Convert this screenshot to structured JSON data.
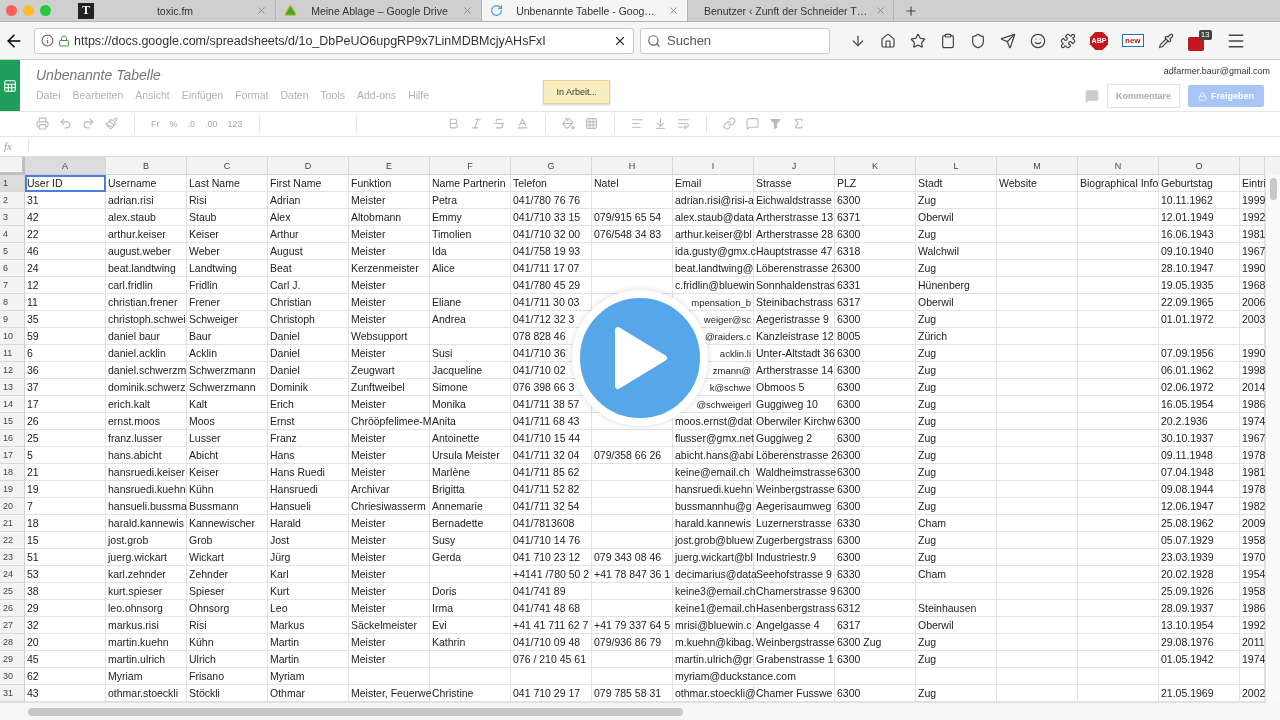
{
  "browser": {
    "tabs": [
      {
        "favicon": "T",
        "title": "toxic.fm",
        "selected": false
      },
      {
        "title": "Meine Ablage – Google Drive",
        "selected": false
      },
      {
        "title": "Unbenannte Tabelle - Goog…",
        "selected": true
      },
      {
        "title": "Benutzer ‹ Zunft der Schneider T…",
        "selected": false
      }
    ],
    "url": "https://docs.google.com/spreadsheets/d/1o_DbPeUO6upgRP9x7LinMDBMcjyAHsFxI",
    "search": {
      "placeholder": "Suchen"
    },
    "adblock": "ABP",
    "news": "new",
    "badge": "13"
  },
  "sheet": {
    "title": "Unbenannte Tabelle",
    "menus": [
      "Datei",
      "Bearbeiten",
      "Ansicht",
      "Einfügen",
      "Format",
      "Daten",
      "Tools",
      "Add-ons",
      "Hilfe"
    ],
    "status": "In Arbeit...",
    "account": "adfarmer.baur@gmail.com",
    "comments": "Kommentare",
    "share": "Freigeben"
  },
  "toolbar": {
    "labels": [
      "Fr",
      "%",
      ".0",
      ".00",
      "123"
    ]
  },
  "formula_bar": {
    "label": "fx"
  },
  "grid": {
    "columns": [
      "A",
      "B",
      "C",
      "D",
      "E",
      "F",
      "G",
      "H",
      "I",
      "J",
      "K",
      "L",
      "M",
      "N",
      "O",
      null
    ],
    "rows": [
      {
        "number": "1",
        "cells": [
          {
            "text": "User ID",
            "selected": true
          },
          "Username",
          "Last Name",
          "First Name",
          "Funktion",
          "Name Partnerin",
          "Telefon",
          "Natel",
          "Email",
          "Strasse",
          "PLZ",
          "Stadt",
          "Website",
          "Biographical Info",
          "Geburtstag",
          "Eintri"
        ]
      },
      {
        "number": "2",
        "cells": [
          "31",
          "adrian.risi",
          "Risi",
          "Adrian",
          "Meister",
          "Petra",
          "041/780 76 76",
          null,
          "adrian.risi@risi-a",
          "Eichwaldstrasse",
          "6300",
          "Zug",
          null,
          null,
          "10.11.1962",
          "1999"
        ]
      },
      {
        "number": "3",
        "cells": [
          "42",
          "alex.staub",
          "Staub",
          "Alex",
          "Altobmann",
          "Emmy",
          "041/710 33 15",
          "079/915 65 54",
          "alex.staub@data",
          "Artherstrasse 13",
          "6371",
          "Oberwil",
          null,
          null,
          "12.01.1949",
          "1992"
        ]
      },
      {
        "number": "4",
        "cells": [
          "22",
          "arthur.keiser",
          "Keiser",
          "Arthur",
          "Meister",
          "Timolien",
          "041/710 32 00",
          "076/548 34 83",
          "arthur.keiser@bl",
          "Artherstrasse 28",
          "6300",
          "Zug",
          null,
          null,
          "16.06.1943",
          "1981"
        ]
      },
      {
        "number": "5",
        "cells": [
          "46",
          "august.weber",
          "Weber",
          "August",
          "Meister",
          "Ida",
          "041/758 19 93",
          null,
          "ida.gusty@gmx.c",
          "Hauptstrasse 47",
          "6318",
          "Walchwil",
          null,
          null,
          "09.10.1940",
          "1967"
        ]
      },
      {
        "number": "6",
        "cells": [
          "24",
          "beat.landtwing",
          "Landtwing",
          "Beat",
          "Kerzenmeister",
          "Alice",
          "041/711 17 07",
          null,
          "beat.landtwing@",
          "Löberenstrasse 2",
          "6300",
          "Zug",
          null,
          null,
          "28.10.1947",
          "1990"
        ]
      },
      {
        "number": "7",
        "cells": [
          "12",
          "carl.fridlin",
          "Fridlin",
          "Carl J.",
          "Meister",
          null,
          "041/780 45 29",
          null,
          "c.fridlin@bluewin",
          "Sonnhaldenstras",
          "6331",
          "Hünenberg",
          null,
          null,
          "19.05.1935",
          "1968"
        ]
      },
      {
        "number": "8",
        "cells": [
          "11",
          "christian.frener",
          "Frener",
          "Christian",
          "Meister",
          "Eliane",
          "041/711 30 03",
          null,
          {
            "text": "mpensation_b",
            "covered": true
          },
          "Steinibachstrass",
          "6317",
          "Oberwil",
          null,
          null,
          "22.09.1965",
          "2006"
        ]
      },
      {
        "number": "9",
        "cells": [
          "35",
          "christoph.schwei",
          "Schweiger",
          "Christoph",
          "Meister",
          "Andrea",
          "041/712 32 3",
          null,
          {
            "text": "weiger@sc",
            "covered": true
          },
          "Aegeristrasse 9",
          "6300",
          "Zug",
          null,
          null,
          "01.01.1972",
          "2003"
        ]
      },
      {
        "number": "10",
        "cells": [
          "59",
          "daniel baur",
          "Baur",
          "Daniel",
          "Websupport",
          null,
          "078 828 46",
          null,
          {
            "text": "@raiders.c",
            "covered": true
          },
          "Kanzleistrase 12",
          "8005",
          "Zürich",
          null,
          null,
          null,
          null
        ]
      },
      {
        "number": "11",
        "cells": [
          "6",
          "daniel.acklin",
          "Acklin",
          "Daniel",
          "Meister",
          "Susi",
          "041/710 36",
          null,
          {
            "text": "acklin.li",
            "covered": true
          },
          "Unter-Altstadt 36",
          "6300",
          "Zug",
          null,
          null,
          "07.09.1956",
          "1990"
        ]
      },
      {
        "number": "12",
        "cells": [
          "36",
          "daniel.schwerzm",
          "Schwerzmann",
          "Daniel",
          "Zeugwart",
          "Jacqueline",
          "041/710 02",
          null,
          {
            "text": "zmann@",
            "covered": true
          },
          "Artherstrasse 14",
          "6300",
          "Zug",
          null,
          null,
          "06.01.1962",
          "1998"
        ]
      },
      {
        "number": "13",
        "cells": [
          "37",
          "dominik.schwerz",
          "Schwerzmann",
          "Dominik",
          "Zunftweibel",
          "Simone",
          "076 398 66 3",
          null,
          {
            "text": "k@schwe",
            "covered": true
          },
          "Obmoos 5",
          "6300",
          "Zug",
          null,
          null,
          "02.06.1972",
          "2014"
        ]
      },
      {
        "number": "14",
        "cells": [
          "17",
          "erich.kalt",
          "Kalt",
          "Erich",
          "Meister",
          "Monika",
          "041/711 38 57",
          null,
          {
            "text": "@schweigerl",
            "covered": true
          },
          "Guggiweg 10",
          "6300",
          "Zug",
          null,
          null,
          "16.05.1954",
          "1986"
        ]
      },
      {
        "number": "15",
        "cells": [
          "26",
          "ernst.moos",
          "Moos",
          "Ernst",
          "Chrööpfelimee-M",
          "Anita",
          "041/711 68 43",
          null,
          "moos.ernst@dat",
          "Oberwiler Kirchw",
          "6300",
          "Zug",
          null,
          null,
          "20.2.1936",
          "1974"
        ]
      },
      {
        "number": "16",
        "cells": [
          "25",
          "franz.lusser",
          "Lusser",
          "Franz",
          "Meister",
          "Antoinette",
          "041/710 15 44",
          null,
          "flusser@gmx.net",
          "Guggiweg 2",
          "6300",
          "Zug",
          null,
          null,
          "30.10.1937",
          "1967"
        ]
      },
      {
        "number": "17",
        "cells": [
          "5",
          "hans.abicht",
          "Abicht",
          "Hans",
          "Meister",
          "Ursula Meister",
          "041/711 32 04",
          "079/358 66 26",
          "abicht.hans@abi",
          "Löberenstrasse 2",
          "6300",
          "Zug",
          null,
          null,
          "09.11.1948",
          "1978"
        ]
      },
      {
        "number": "18",
        "cells": [
          "21",
          "hansruedi.keiser",
          "Keiser",
          "Hans Ruedi",
          "Meister",
          "Marlène",
          "041/711 85 62",
          null,
          "keine@email.ch",
          "Waldheimstrasse",
          "6300",
          "Zug",
          null,
          null,
          "07.04.1948",
          "1981"
        ]
      },
      {
        "number": "19",
        "cells": [
          "19",
          "hansruedi.kuehn",
          "Kühn",
          "Hansruedi",
          "Archivar",
          "Brigitta",
          "041/711 52 82",
          null,
          "hansruedi.kuehn",
          "Weinbergstrasse",
          "6300",
          "Zug",
          null,
          null,
          "09.08.1944",
          "1978"
        ]
      },
      {
        "number": "20",
        "cells": [
          "7",
          "hansueli.bussma",
          "Bussmann",
          "Hansueli",
          "Chriesiwasserm",
          "Annemarie",
          "041/711 32 54",
          null,
          "bussmannhu@g",
          "Aegerisaumweg",
          "6300",
          "Zug",
          null,
          null,
          "12.06.1947",
          "1982"
        ]
      },
      {
        "number": "21",
        "cells": [
          "18",
          "harald.kannewis",
          "Kannewischer",
          "Harald",
          "Meister",
          "Bernadette",
          "041/7813608",
          null,
          "harald.kannewis",
          "Luzernerstrasse",
          "6330",
          "Cham",
          null,
          null,
          "25.08.1962",
          "2009"
        ]
      },
      {
        "number": "22",
        "cells": [
          "15",
          "jost.grob",
          "Grob",
          "Jost",
          "Meister",
          "Susy",
          "041/710 14 76",
          null,
          "jost.grob@bluew",
          "Zugerbergstrass",
          "6300",
          "Zug",
          null,
          null,
          "05.07.1929",
          "1958"
        ]
      },
      {
        "number": "23",
        "cells": [
          "51",
          "juerg.wickart",
          "Wickart",
          "Jürg",
          "Meister",
          "Gerda",
          "041 710 23 12",
          "079 343 08 46",
          "juerg.wickart@bl",
          "Industriestr.9",
          "6300",
          "Zug",
          null,
          null,
          "23.03.1939",
          "1970"
        ]
      },
      {
        "number": "24",
        "cells": [
          "53",
          "karl.zehnder",
          "Zehnder",
          "Karl",
          "Meister",
          null,
          "+4141 /780 50 2",
          "+41 78 847 36 1",
          "decimarius@data",
          "Seehofstrasse 9",
          "6330",
          "Cham",
          null,
          null,
          "20.02.1928",
          "1954"
        ]
      },
      {
        "number": "25",
        "cells": [
          "38",
          "kurt.spieser",
          "Spieser",
          "Kurt",
          "Meister",
          "Doris",
          "041/741 89",
          null,
          "keine3@email.ch",
          "Chamerstrasse 9",
          "6300",
          null,
          null,
          null,
          "25.09.1926",
          "1958"
        ]
      },
      {
        "number": "26",
        "cells": [
          "29",
          "leo.ohnsorg",
          "Ohnsorg",
          "Leo",
          "Meister",
          "Irma",
          "041/741 48 68",
          null,
          "keine1@email.ch",
          "Hasenbergstrass",
          "6312",
          "Steinhausen",
          null,
          null,
          "28.09.1937",
          "1986"
        ]
      },
      {
        "number": "27",
        "cells": [
          "32",
          "markus.risi",
          "Risi",
          "Markus",
          "Säckelmeister",
          "Evi",
          "+41 41 711 62 7",
          "+41 79 337 64 5",
          "mrisi@bluewin.c",
          "Angelgasse 4",
          "6317",
          "Oberwil",
          null,
          null,
          "13.10.1954",
          "1992"
        ]
      },
      {
        "number": "28",
        "cells": [
          "20",
          "martin.kuehn",
          "Kühn",
          "Martin",
          "Meister",
          "Kathrin",
          "041/710 09 48",
          "079/936 86 79",
          "m.kuehn@kibag.",
          "Weinbergstrasse",
          "6300 Zug",
          "Zug",
          null,
          null,
          "29.08.1976",
          "2011"
        ]
      },
      {
        "number": "29",
        "cells": [
          "45",
          "martin.ulrich",
          "Ulrich",
          "Martin",
          "Meister",
          null,
          "076 / 210 45 61",
          null,
          "martin.ulrich@gr",
          "Grabenstrasse 1",
          "6300",
          "Zug",
          null,
          null,
          "01.05.1942",
          "1974"
        ]
      },
      {
        "number": "30",
        "cells": [
          "62",
          "Myriam",
          "Frisano",
          "Myriam",
          null,
          null,
          null,
          null,
          {
            "text": "myriam@duckstance.com",
            "overflow": true
          },
          null,
          null,
          null,
          null,
          null,
          null,
          null
        ]
      },
      {
        "number": "31",
        "cells": [
          "43",
          "othmar.stoeckli",
          "Stöckli",
          "Othmar",
          "Meister, Feuerwe",
          "Christine",
          "041 710 29 17",
          "079 785 58 31",
          "othmar.stoeckli@",
          "Chamer Fusswe",
          "6300",
          "Zug",
          null,
          null,
          "21.05.1969",
          "2002"
        ]
      }
    ]
  }
}
